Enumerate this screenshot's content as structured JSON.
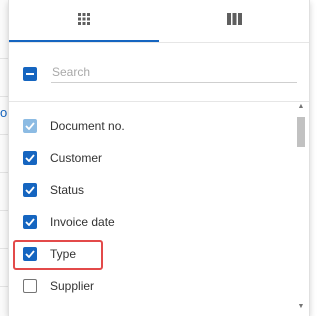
{
  "background": {
    "left_fragment": "o"
  },
  "tabs": [
    {
      "icon": "grid-icon",
      "active": true
    },
    {
      "icon": "columns-icon",
      "active": false
    }
  ],
  "search": {
    "placeholder": "Search",
    "value": ""
  },
  "select_all": {
    "state": "indeterminate"
  },
  "columns": [
    {
      "label": "Document no.",
      "state": "checked-disabled"
    },
    {
      "label": "Customer",
      "state": "checked"
    },
    {
      "label": "Status",
      "state": "checked"
    },
    {
      "label": "Invoice date",
      "state": "checked"
    },
    {
      "label": "Type",
      "state": "checked"
    },
    {
      "label": "Supplier",
      "state": "unchecked",
      "highlighted": true
    }
  ],
  "colors": {
    "accent": "#1565c0",
    "accent_disabled": "#8cbbe3",
    "highlight_border": "#e34a4a"
  }
}
